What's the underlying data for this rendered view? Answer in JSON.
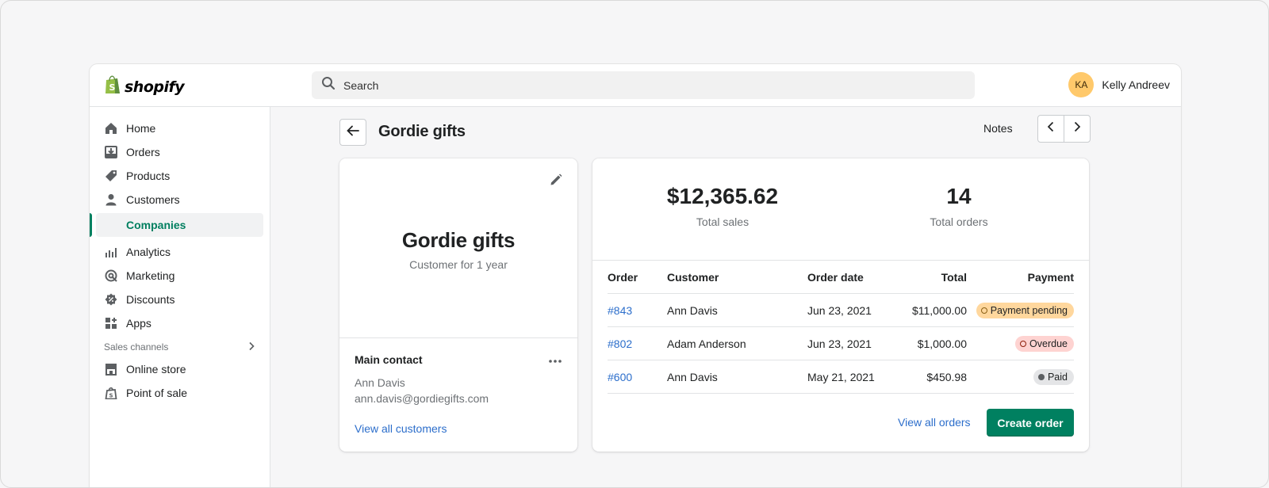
{
  "app": {
    "brand": "shopify",
    "brand_color": "#95bf47",
    "accent": "#008060",
    "link_color": "#2c6ecb"
  },
  "search": {
    "placeholder": "Search"
  },
  "user": {
    "initials": "KA",
    "name": "Kelly Andreev"
  },
  "sidebar": {
    "items": [
      {
        "label": "Home",
        "icon": "home-icon"
      },
      {
        "label": "Orders",
        "icon": "orders-icon"
      },
      {
        "label": "Products",
        "icon": "tag-icon"
      },
      {
        "label": "Customers",
        "icon": "person-icon"
      }
    ],
    "active_sub": "Companies",
    "items2": [
      {
        "label": "Analytics",
        "icon": "bar-chart-icon"
      },
      {
        "label": "Marketing",
        "icon": "target-icon"
      },
      {
        "label": "Discounts",
        "icon": "discount-icon"
      },
      {
        "label": "Apps",
        "icon": "apps-icon"
      }
    ],
    "section_title": "Sales channels",
    "channels": [
      {
        "label": "Online store",
        "icon": "store-icon"
      },
      {
        "label": "Point of sale",
        "icon": "pos-icon"
      }
    ]
  },
  "page": {
    "title": "Gordie gifts",
    "notes_label": "Notes"
  },
  "company": {
    "name": "Gordie gifts",
    "since": "Customer for 1 year",
    "contact_title": "Main contact",
    "contact_name": "Ann Davis",
    "contact_email": "ann.davis@gordiegifts.com",
    "view_all_label": "View all customers"
  },
  "stats": {
    "total_sales_value": "$12,365.62",
    "total_sales_label": "Total sales",
    "total_orders_value": "14",
    "total_orders_label": "Total orders"
  },
  "orders": {
    "headers": {
      "order": "Order",
      "customer": "Customer",
      "date": "Order date",
      "total": "Total",
      "payment": "Payment"
    },
    "rows": [
      {
        "order": "#843",
        "customer": "Ann Davis",
        "date": "Jun 23, 2021",
        "total": "$11,000.00",
        "payment": "Payment pending"
      },
      {
        "order": "#802",
        "customer": "Adam Anderson",
        "date": "Jun 23, 2021",
        "total": "$1,000.00",
        "payment": "Overdue"
      },
      {
        "order": "#600",
        "customer": "Ann Davis",
        "date": "May 21, 2021",
        "total": "$450.98",
        "payment": "Paid"
      }
    ],
    "view_all_label": "View all orders",
    "create_label": "Create order"
  }
}
